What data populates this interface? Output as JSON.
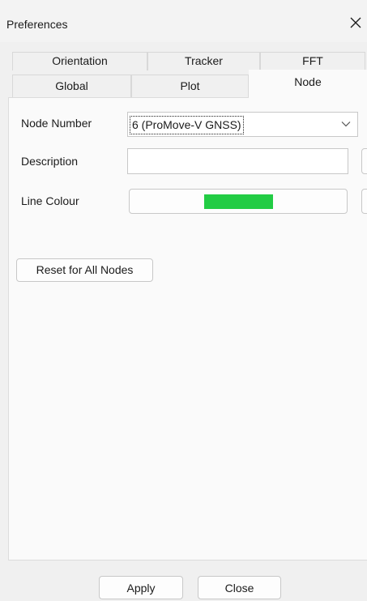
{
  "window": {
    "title": "Preferences"
  },
  "tabs": {
    "row1": [
      {
        "label": "Orientation"
      },
      {
        "label": "Tracker"
      },
      {
        "label": "FFT"
      }
    ],
    "row2": [
      {
        "label": "Global"
      },
      {
        "label": "Plot"
      },
      {
        "label": "Node",
        "active": true
      }
    ]
  },
  "node": {
    "node_number_label": "Node Number",
    "node_number_value": "6 (ProMove-V GNSS)",
    "description_label": "Description",
    "description_value": "",
    "line_colour_label": "Line Colour",
    "line_colour_value": "#22cc44",
    "reset_button": "Reset for All Nodes"
  },
  "footer": {
    "apply_button": "Apply",
    "close_button": "Close"
  }
}
